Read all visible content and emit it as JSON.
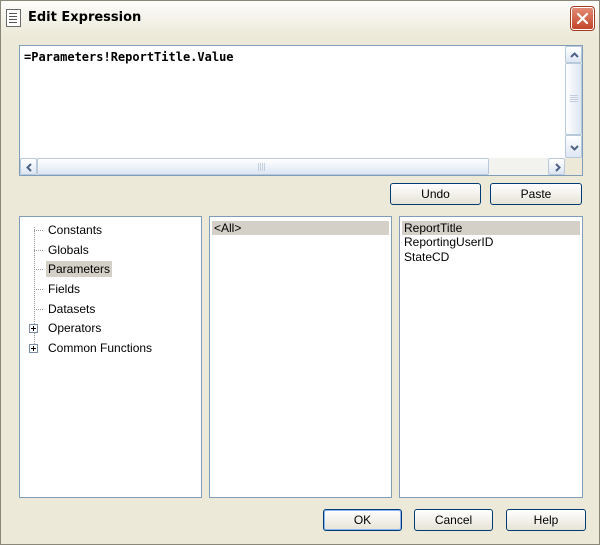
{
  "window": {
    "title": "Edit Expression"
  },
  "expression": {
    "text": "=Parameters!ReportTitle.Value"
  },
  "editor_buttons": {
    "undo": "Undo",
    "paste": "Paste"
  },
  "categories": {
    "items": [
      {
        "label": "Constants",
        "expandable": false,
        "selected": false
      },
      {
        "label": "Globals",
        "expandable": false,
        "selected": false
      },
      {
        "label": "Parameters",
        "expandable": false,
        "selected": true
      },
      {
        "label": "Fields",
        "expandable": false,
        "selected": false
      },
      {
        "label": "Datasets",
        "expandable": false,
        "selected": false
      },
      {
        "label": "Operators",
        "expandable": true,
        "selected": false
      },
      {
        "label": "Common Functions",
        "expandable": true,
        "selected": false
      }
    ]
  },
  "subcategories": {
    "items": [
      {
        "label": "<All>",
        "selected": true
      }
    ]
  },
  "members": {
    "items": [
      {
        "label": "ReportTitle",
        "selected": true
      },
      {
        "label": "ReportingUserID",
        "selected": false
      },
      {
        "label": "StateCD",
        "selected": false
      }
    ]
  },
  "dialog_buttons": {
    "ok": "OK",
    "cancel": "Cancel",
    "help": "Help"
  }
}
